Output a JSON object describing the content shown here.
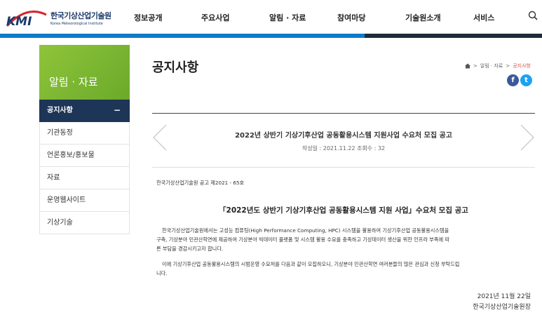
{
  "header": {
    "logo_mark": "KMI",
    "logo_kr": "한국기상산업기술원",
    "logo_en": "Korea Meteorological Institute",
    "nav": [
      "정보공개",
      "주요사업",
      "알림 · 자료",
      "참여마당",
      "기술원소개",
      "서비스"
    ],
    "colors": {
      "accent_blue": "#0e7bc9",
      "dark": "#1e2b3a",
      "logo_red": "#d7262e"
    }
  },
  "sidebar": {
    "title": "알림 · 자료",
    "items": [
      {
        "label": "공지사항",
        "active": true
      },
      {
        "label": "기관동정"
      },
      {
        "label": "언론홍보/홍보물"
      },
      {
        "label": "자료"
      },
      {
        "label": "운영웹사이트"
      },
      {
        "label": "기상기술"
      }
    ],
    "active_marker": "−"
  },
  "content": {
    "page_title": "공지사항",
    "breadcrumb": [
      "알림 · 자료",
      "공지사항"
    ],
    "sns": [
      "f",
      "t"
    ],
    "post": {
      "title": "2022년 상반기 기상기후산업 공동활용시스템 지원사업 수요처 모집 공고",
      "meta": "작성일 : 2021.11.22    조회수 : 32",
      "notice_no": "한국기상산업기술원 공고 제2021 - 65호",
      "headline": "「2022년도 상반기 기상기후산업 공동활용시스템 지원 사업」수요처 모집 공고",
      "para1_line1": "한국기상산업기술원에서는 고성능 컴퓨팅(High Performance Computing, HPC) 시스템을 활용하여 기상기후산업 공동활용시스템을",
      "para1_line2": "구축, 기상분야 민관산학연에 제공하여 기상분야 빅데이터 플랫폼 및 시스템 활용 수요를 충족하고 기상데이터 생산을 위한 인프라 부족에 따",
      "para1_line3": "른 부담을 경감시키고자 합니다.",
      "para2_line1": "이에 기상기후산업 공동활용시스템의 시범운영 수요처를 다음과 같이 모집하오니, 기상분야 민관산학연 여러분들의 많은 관심과 신청 부탁드립",
      "para2_line2": "니다.",
      "date": "2021년 11월 22일",
      "signature": "한국기상산업기술원장"
    }
  }
}
